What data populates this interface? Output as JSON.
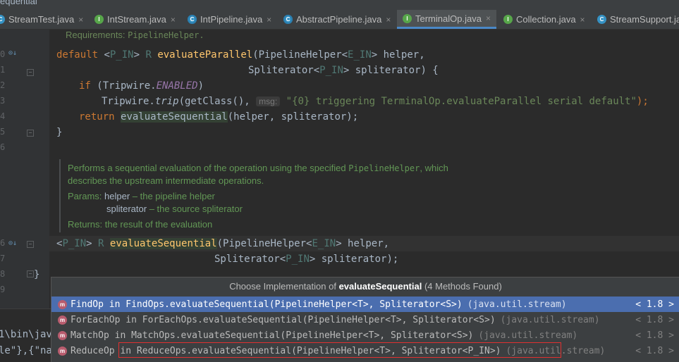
{
  "top_strip_text": "equential",
  "tabs": [
    {
      "label": "StreamTest.java",
      "icon": "class-icon",
      "close": "×"
    },
    {
      "label": "IntStream.java",
      "icon": "interface-icon",
      "close": "×"
    },
    {
      "label": "IntPipeline.java",
      "icon": "abstract-class-icon",
      "close": "×"
    },
    {
      "label": "AbstractPipeline.java",
      "icon": "abstract-class-icon",
      "close": "×"
    },
    {
      "label": "TerminalOp.java",
      "icon": "interface-icon",
      "close": "×",
      "active": true
    },
    {
      "label": "Collection.java",
      "icon": "interface-icon",
      "close": "×"
    },
    {
      "label": "StreamSupport.java",
      "icon": "class-icon",
      "close": "×"
    }
  ],
  "gutter_numbers": [
    "0",
    "1",
    "2",
    "3",
    "4",
    "5",
    "6",
    "",
    "",
    "",
    "",
    "",
    "",
    "",
    "6",
    "7",
    "8",
    "9"
  ],
  "code": {
    "requirements_label": "Requirements:",
    "requirements_value": "PipelineHelper.",
    "l1_default": "default",
    "l1_rest_a": " <",
    "l1_type": "P_IN",
    "l1_rest_b": "> ",
    "l1_r": "R",
    "l1_method": " evaluateParallel",
    "l1_params_a": "(PipelineHelper<",
    "l1_type2": "E_IN",
    "l1_params_b": "> helper,",
    "l2_a": "Spliterator<",
    "l2_type": "P_IN",
    "l2_b": "> spliterator) {",
    "l3_if": "if",
    "l3_a": " (Tripwire.",
    "l3_const": "ENABLED",
    "l3_b": ")",
    "l4_a": "Tripwire.",
    "l4_trip": "trip",
    "l4_b": "(getClass(),",
    "l4_hint": "msg:",
    "l4_str": "\"{0} triggering TerminalOp.evaluateParallel serial default\"",
    "l4_c": ");",
    "l5_return": "return",
    "l5_call": "evaluateSequential",
    "l5_rest": "(helper, spliterator);",
    "l6_brace": "}",
    "s1_a": "<",
    "s1_type": "P_IN",
    "s1_b": "> ",
    "s1_r": "R",
    "s1_method": "evaluateSequential",
    "s1_params_a": "(PipelineHelper<",
    "s1_type2": "E_IN",
    "s1_params_b": "> helper,",
    "s2_a": "Spliterator<",
    "s2_type": "P_IN",
    "s2_b": "> spliterator);",
    "close_brace": "}"
  },
  "doc": {
    "line1_a": "Performs a sequential evaluation of the operation using the specified ",
    "line1_mono": "PipelineHelper",
    "line1_b": ", which",
    "line2": "describes the upstream intermediate operations.",
    "params_label": "Params:",
    "p1_name": "helper",
    "p1_desc": " – the pipeline helper",
    "p2_name": "spliterator",
    "p2_desc": " – the source spliterator",
    "returns_label": "Returns:",
    "returns_desc": " the result of the evaluation"
  },
  "popup": {
    "title_prefix": "Choose Implementation of ",
    "title_method": "evaluateSequential",
    "title_suffix": " (4 Methods Found)",
    "items": [
      {
        "text": "FindOp in FindOps.evaluateSequential(PipelineHelper<T>, Spliterator<S>)",
        "pkg": "(java.util.stream)",
        "version": "< 1.8 >",
        "selected": true
      },
      {
        "text": "ForEachOp in ForEachOps.evaluateSequential(PipelineHelper<T>, Spliterator<S>)",
        "pkg": "(java.util.stream)",
        "version": "< 1.8 >"
      },
      {
        "text": "MatchOp in MatchOps.evaluateSequential(PipelineHelper<T>, Spliterator<S>)",
        "pkg": "(java.util.stream)",
        "version": "< 1.8 >"
      },
      {
        "text": "ReduceOp in ReduceOps.evaluateSequential(PipelineHelper<T>, Spliterator<P_IN>)",
        "pkg": "(java.util.stream)",
        "version": "< 1.8 >",
        "highlighted": true
      }
    ],
    "method_icon": "m"
  },
  "terminal": {
    "line1": "1\\bin\\jav",
    "line2": "le\"},{\"na"
  }
}
